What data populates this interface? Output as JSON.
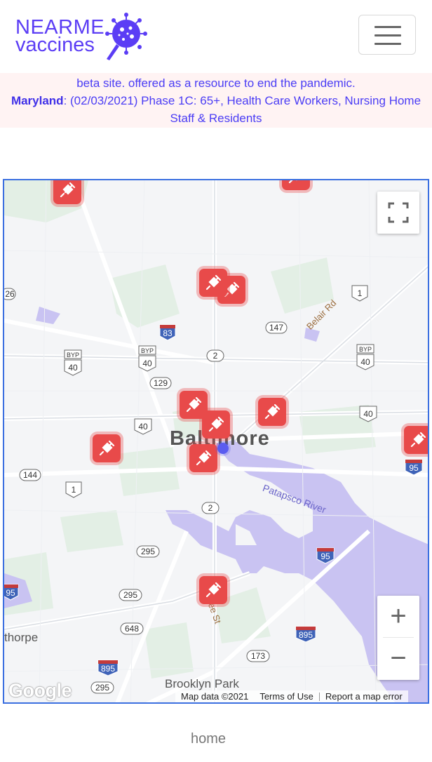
{
  "header": {
    "logo": {
      "line1": "NEARME",
      "line2": "vaccines"
    },
    "menu_toggle": {
      "icon": "hamburger-menu-icon"
    }
  },
  "banner": {
    "line1": "beta site. offered as a resource to end the pandemic.",
    "state": "Maryland",
    "info": ": (02/03/2021) Phase 1C: 65+, Health Care Workers, Nursing Home Staff & Residents"
  },
  "map": {
    "city_label": "Baltimore",
    "places": {
      "brooklyn_park": "Brooklyn Park",
      "thorpe": "thorpe"
    },
    "roads": {
      "belair": "Belair Rd",
      "patapsco": "Patapsco River",
      "st": "ee St"
    },
    "shields": [
      "26",
      "83",
      "147",
      "1",
      "BYP 40",
      "BYP 40",
      "BYP 40",
      "2",
      "129",
      "40",
      "40",
      "144",
      "1",
      "2",
      "295",
      "295",
      "95",
      "95",
      "95",
      "648",
      "895",
      "895",
      "173",
      "295"
    ],
    "shield_labels": {
      "s26": "26",
      "s83": "83",
      "s147": "147",
      "s1a": "1",
      "s2a": "2",
      "s129": "129",
      "s40a": "40",
      "s40b": "40",
      "s144": "144",
      "s1b": "1",
      "s2b": "2",
      "s295a": "295",
      "s295b": "295",
      "s95a": "95",
      "s95b": "95",
      "s95c": "95",
      "s648": "648",
      "s895a": "895",
      "s895b": "895",
      "s173": "173",
      "s295c": "295",
      "byp": "BYP",
      "byp40": "40"
    },
    "marker_icon": "syringe-icon",
    "fullscreen_icon": "fullscreen-icon",
    "zoom_in": "+",
    "zoom_out": "−",
    "attribution": {
      "logo": "Google",
      "map_data": "Map data ©2021",
      "terms": "Terms of Use",
      "report": "Report a map error"
    },
    "colors": {
      "water": "#c9c3f2",
      "pin": "#e84a4a",
      "border": "#3b6fe0",
      "user_location": "#5a5cf0"
    }
  },
  "footer": {
    "home_link": "home"
  }
}
